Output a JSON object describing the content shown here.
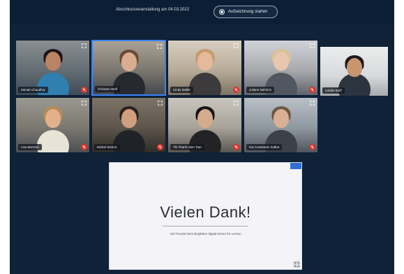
{
  "header": {
    "meeting_title": "Abschlussveranstaltung am 04.03.2022",
    "record_label": "Aufzeichnung starten"
  },
  "participants": [
    {
      "name": "Zeinab Chaudhry",
      "muted": true
    },
    {
      "name": "Christine Wolf",
      "muted": false,
      "active": true
    },
    {
      "name": "Cindy Müller",
      "muted": true
    },
    {
      "name": "Juliane Nehrlich",
      "muted": true
    },
    {
      "name": "Cäcilie Bolff",
      "muted": false
    },
    {
      "name": "Lisa Bertram",
      "muted": true
    },
    {
      "name": "Michel Sieburt",
      "muted": true
    },
    {
      "name": "Thi Thanh Hien Tran",
      "muted": true
    },
    {
      "name": "Kai Constantin Sulbot",
      "muted": true
    }
  ],
  "slide": {
    "title": "Vielen Dank!",
    "subtitle": "Viel Freude beim Begleiten digital lernen für Lernen"
  },
  "colors": {
    "app_background": "#0f2238",
    "active_speaker": "#3b82f6",
    "muted_indicator": "#e0352f",
    "slide_accent": "#2f6fd6"
  },
  "icons": {
    "record": "record-icon",
    "mute": "mic-off-icon",
    "expand": "expand-icon",
    "fullscreen": "fullscreen-icon"
  }
}
